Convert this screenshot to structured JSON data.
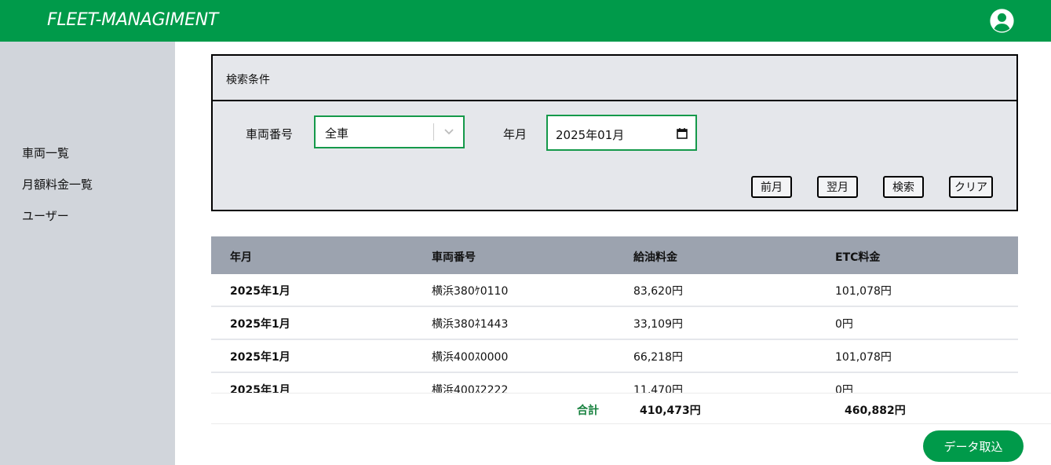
{
  "header": {
    "brand": "FLEET-MANAGIMENT",
    "user_icon": "user-circle-icon"
  },
  "sidebar": {
    "items": [
      {
        "label": "車両一覧"
      },
      {
        "label": "月額料金一覧"
      },
      {
        "label": "ユーザー"
      }
    ]
  },
  "search": {
    "title": "検索条件",
    "vehicle_label": "車両番号",
    "vehicle_value": "全車",
    "month_label": "年月",
    "month_value": "2025年01月",
    "buttons": {
      "prev": "前月",
      "next": "翌月",
      "search": "検索",
      "clear": "クリア"
    }
  },
  "table": {
    "columns": [
      "年月",
      "車両番号",
      "給油料金",
      "ETC料金"
    ],
    "rows": [
      [
        "2025年1月",
        "横浜380ｹ0110",
        "83,620円",
        "101,078円"
      ],
      [
        "2025年1月",
        "横浜380ﾈ1443",
        "33,109円",
        "0円"
      ],
      [
        "2025年1月",
        "横浜400ｽ0000",
        "66,218円",
        "101,078円"
      ],
      [
        "2025年1月",
        "横浜400ｽ2222",
        "11,470円",
        "0円"
      ]
    ]
  },
  "totals": {
    "label": "合計",
    "fuel": "410,473円",
    "etc": "460,882円"
  },
  "actions": {
    "import": "データ取込"
  },
  "colors": {
    "brand": "#009a4a",
    "sidebar": "#d1d5db",
    "panel": "#e5e7eb",
    "table_header": "#9ca3af"
  }
}
